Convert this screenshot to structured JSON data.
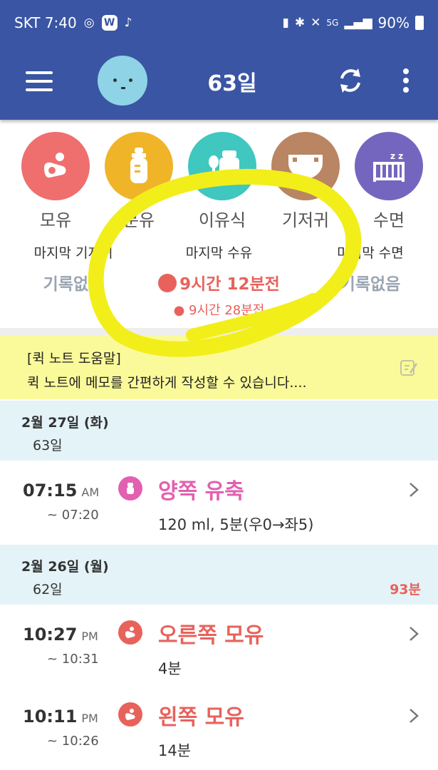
{
  "status_bar": {
    "carrier_time": "SKT 7:40",
    "battery": "90%",
    "w_badge": "W",
    "five_g": "5G"
  },
  "app_bar": {
    "title": "63일"
  },
  "categories": [
    {
      "label": "모유",
      "color": "#ef6f6f",
      "icon": "breastfeeding-icon"
    },
    {
      "label": "분유",
      "color": "#f0b429",
      "icon": "bottle-icon"
    },
    {
      "label": "이유식",
      "color": "#3fc7c0",
      "icon": "baby-food-icon"
    },
    {
      "label": "기저귀",
      "color": "#b98562",
      "icon": "diaper-icon"
    },
    {
      "label": "수면",
      "color": "#7466bf",
      "icon": "crib-icon"
    }
  ],
  "summary": {
    "diaper": {
      "title": "마지막 기저귀",
      "value": "기록없음"
    },
    "feeding": {
      "title": "마지막 수유",
      "value": "9시간 12분전",
      "sub": "9시간 28분전"
    },
    "sleep": {
      "title": "마지막 수면",
      "value": "기록없음"
    }
  },
  "quick_note": {
    "title": "[퀵 노트 도움말]",
    "body": "퀵 노트에 메모를 간편하게 작성할 수 있습니다...."
  },
  "days": [
    {
      "date": "2월 27일 (화)",
      "day_count": "63일",
      "total": "",
      "entries": [
        {
          "time": "07:15",
          "ampm": "AM",
          "end": "~ 07:20",
          "title": "양쪽 유축",
          "detail": "120 ml, 5분(우0→좌5)",
          "color": "#e35fb0",
          "icon": "pump-icon"
        }
      ]
    },
    {
      "date": "2월 26일 (월)",
      "day_count": "62일",
      "total": "93분",
      "entries": [
        {
          "time": "10:27",
          "ampm": "PM",
          "end": "~ 10:31",
          "title": "오른쪽 모유",
          "detail": "4분",
          "color": "#e8625c",
          "icon": "breastfeeding-icon"
        },
        {
          "time": "10:11",
          "ampm": "PM",
          "end": "~ 10:26",
          "title": "왼쪽 모유",
          "detail": "14분",
          "color": "#e8625c",
          "icon": "breastfeeding-icon"
        }
      ]
    }
  ]
}
